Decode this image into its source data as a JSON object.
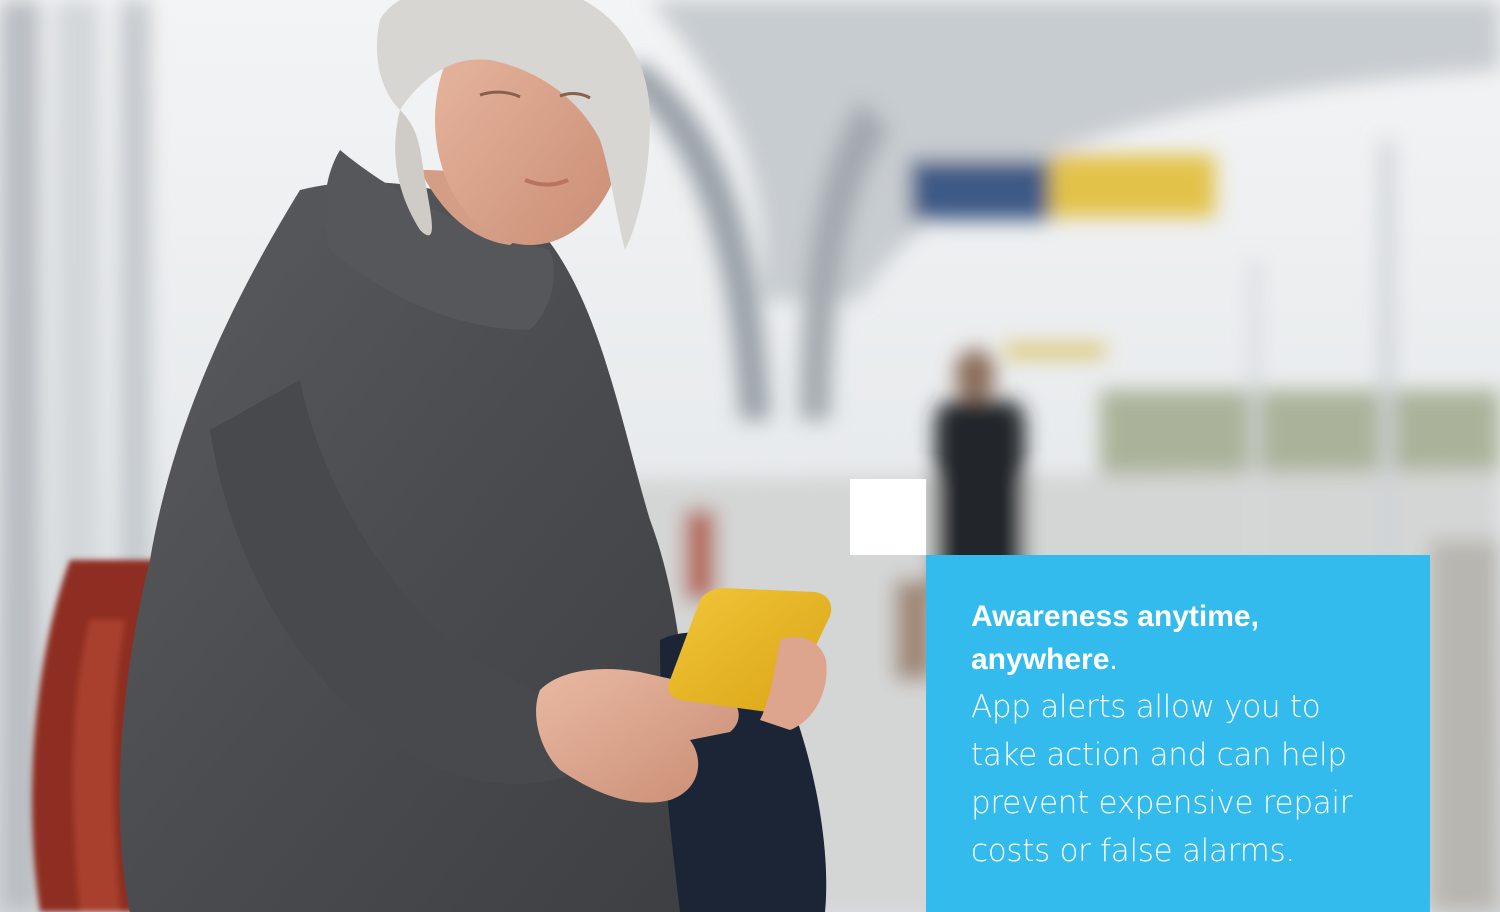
{
  "callout": {
    "title": "Awareness anytime, anywhere",
    "title_punctuation": ".",
    "body": "App alerts allow you to take action and can help prevent expensive repair costs or false alarms."
  },
  "colors": {
    "callout_background": "#33bbee",
    "callout_text": "#ffffff",
    "square": "#ffffff"
  }
}
